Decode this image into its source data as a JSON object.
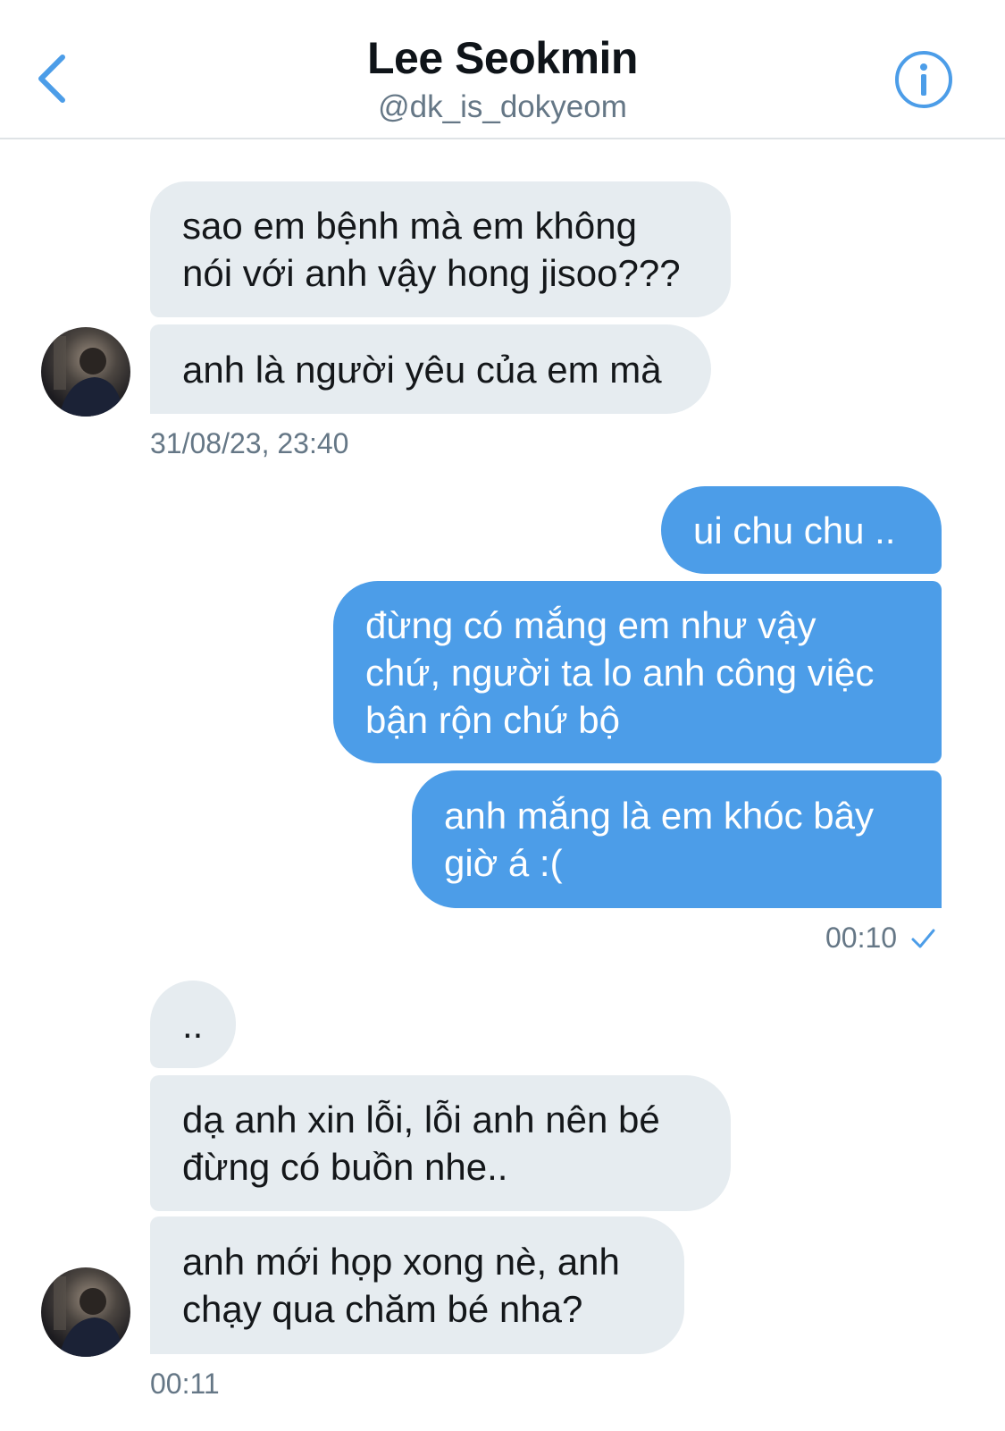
{
  "header": {
    "name": "Lee Seokmin",
    "handle": "@dk_is_dokyeom",
    "back_icon": "chevron-left-icon",
    "info_icon": "info-icon",
    "accent_color": "#4c9de8"
  },
  "messages": [
    {
      "lines": [
        "sao em bệnh mà em không",
        "nói với anh vậy hong jisoo???"
      ]
    },
    {
      "lines": [
        "anh là người yêu của em mà"
      ]
    },
    {
      "lines": [
        "ui chu chu .."
      ]
    },
    {
      "lines": [
        "đừng có mắng em như vậy",
        "chứ, người ta lo anh công việc",
        "bận rộn chứ bộ"
      ]
    },
    {
      "lines": [
        "anh mắng là em khóc bây",
        "giờ á :("
      ]
    },
    {
      "lines": [
        ".."
      ]
    },
    {
      "lines": [
        "dạ anh xin lỗi, lỗi anh nên bé",
        "đừng có buồn nhe.."
      ]
    },
    {
      "lines": [
        "anh mới họp xong nè, anh",
        "chạy qua chăm bé nha?"
      ]
    }
  ],
  "timestamps": {
    "t1": "31/08/23, 23:40",
    "t2": "00:10",
    "t3": "00:11"
  },
  "read_receipt_icon": "checkmark-icon",
  "colors": {
    "incoming_bubble": "#e6ecf0",
    "outgoing_bubble": "#4c9de8",
    "muted_text": "#657786"
  }
}
